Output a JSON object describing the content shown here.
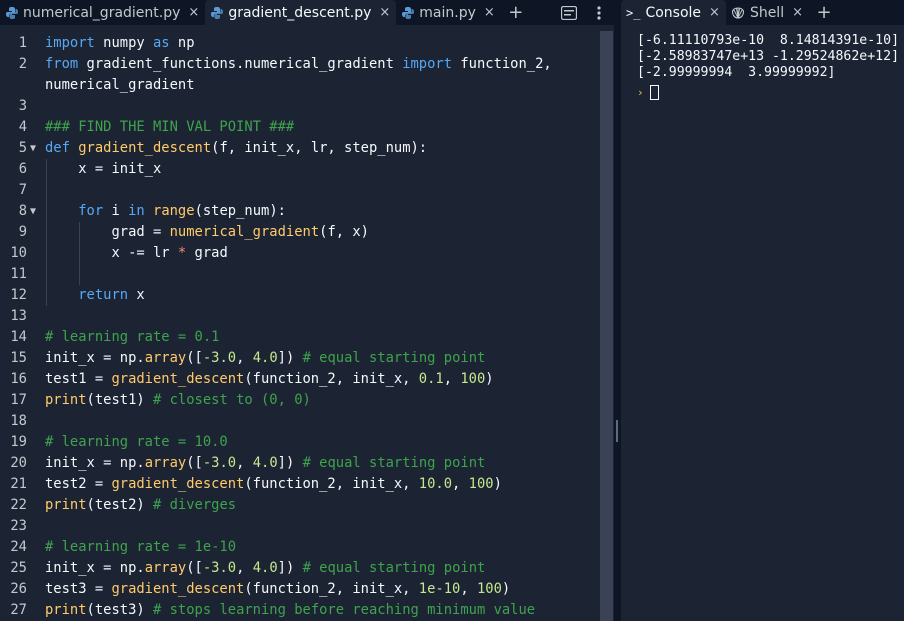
{
  "editor": {
    "tabs": [
      {
        "label": "numerical_gradient.py",
        "active": false
      },
      {
        "label": "gradient_descent.py",
        "active": true
      },
      {
        "label": "main.py",
        "active": false
      }
    ],
    "close_glyph": "×",
    "add_glyph": "+",
    "lines": [
      {
        "n": "1",
        "fold": "",
        "html": "<span class='kw'>import</span> numpy <span class='kw'>as</span> np"
      },
      {
        "n": "2",
        "fold": "",
        "html": "<span class='kw'>from</span> gradient_functions.numerical_gradient <span class='kw'>import</span> function_2,"
      },
      {
        "n": "",
        "fold": "",
        "html": "numerical_gradient"
      },
      {
        "n": "3",
        "fold": "",
        "html": ""
      },
      {
        "n": "4",
        "fold": "",
        "html": "<span class='cm'>### FIND THE MIN VAL POINT ###</span>"
      },
      {
        "n": "5",
        "fold": "▼",
        "html": "<span class='kw'>def</span> <span class='fn'>gradient_descent</span>(f, init_x, lr, step_num):"
      },
      {
        "n": "6",
        "fold": "",
        "html": "    x = init_x",
        "g1": true
      },
      {
        "n": "7",
        "fold": "",
        "html": "",
        "g1": true
      },
      {
        "n": "8",
        "fold": "▼",
        "html": "    <span class='kw'>for</span> i <span class='kw'>in</span> <span class='fn'>range</span>(step_num):",
        "g1": true
      },
      {
        "n": "9",
        "fold": "",
        "html": "        grad = <span class='fn'>numerical_gradient</span>(f, x)",
        "g1": true,
        "g2": true
      },
      {
        "n": "10",
        "fold": "",
        "html": "        x -= lr <span class='op'>*</span> grad",
        "g1": true,
        "g2": true
      },
      {
        "n": "11",
        "fold": "",
        "html": "",
        "g1": true,
        "g2": true
      },
      {
        "n": "12",
        "fold": "",
        "html": "    <span class='kw'>return</span> x",
        "g1": true
      },
      {
        "n": "13",
        "fold": "",
        "html": ""
      },
      {
        "n": "14",
        "fold": "",
        "html": "<span class='cm'># learning rate = 0.1</span>"
      },
      {
        "n": "15",
        "fold": "",
        "html": "init_x = np.<span class='fn'>array</span>([<span class='num'>-3.0</span>, <span class='num'>4.0</span>]) <span class='cm'># equal starting point</span>"
      },
      {
        "n": "16",
        "fold": "",
        "html": "test1 = <span class='fn'>gradient_descent</span>(function_2, init_x, <span class='num'>0.1</span>, <span class='num'>100</span>)"
      },
      {
        "n": "17",
        "fold": "",
        "html": "<span class='fn'>print</span>(test1) <span class='cm'># closest to (0, 0)</span>"
      },
      {
        "n": "18",
        "fold": "",
        "html": ""
      },
      {
        "n": "19",
        "fold": "",
        "html": "<span class='cm'># learning rate = 10.0</span>"
      },
      {
        "n": "20",
        "fold": "",
        "html": "init_x = np.<span class='fn'>array</span>([<span class='num'>-3.0</span>, <span class='num'>4.0</span>]) <span class='cm'># equal starting point</span>"
      },
      {
        "n": "21",
        "fold": "",
        "html": "test2 = <span class='fn'>gradient_descent</span>(function_2, init_x, <span class='num'>10.0</span>, <span class='num'>100</span>)"
      },
      {
        "n": "22",
        "fold": "",
        "html": "<span class='fn'>print</span>(test2) <span class='cm'># diverges</span>"
      },
      {
        "n": "23",
        "fold": "",
        "html": ""
      },
      {
        "n": "24",
        "fold": "",
        "html": "<span class='cm'># learning rate = 1e-10</span>"
      },
      {
        "n": "25",
        "fold": "",
        "html": "init_x = np.<span class='fn'>array</span>([<span class='num'>-3.0</span>, <span class='num'>4.0</span>]) <span class='cm'># equal starting point</span>"
      },
      {
        "n": "26",
        "fold": "",
        "html": "test3 = <span class='fn'>gradient_descent</span>(function_2, init_x, <span class='num'>1e-10</span>, <span class='num'>100</span>)"
      },
      {
        "n": "27",
        "fold": "",
        "html": "<span class='fn'>print</span>(test3) <span class='cm'># stops learning before reaching minimum value</span>"
      }
    ]
  },
  "console": {
    "tabs": [
      {
        "label": "Console",
        "icon": ">_",
        "active": true
      },
      {
        "label": "Shell",
        "icon": "shell-icon",
        "active": false
      }
    ],
    "output": [
      "[-6.11110793e-10  8.14814391e-10]",
      "[-2.58983747e+13 -1.29524862e+12]",
      "[-2.99999994  3.99999992]"
    ],
    "prompt_glyph": "›"
  },
  "colors": {
    "editor_bg": "#1c2333",
    "tabbar_bg": "#0e1525",
    "keyword": "#56a8f5",
    "function": "#ffcb6b",
    "number": "#c3e88d",
    "comment": "#3fa34d"
  }
}
